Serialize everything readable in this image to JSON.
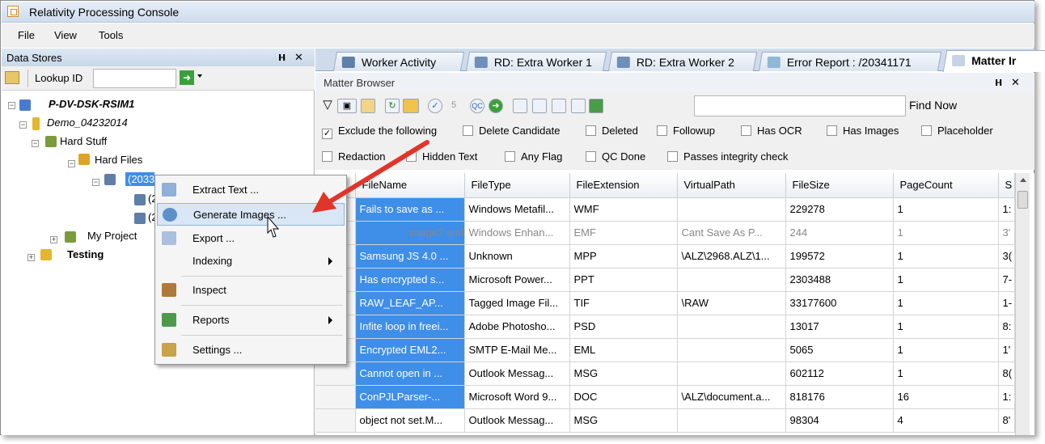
{
  "window": {
    "title": "Relativity Processing Console"
  },
  "menu": [
    "File",
    "View",
    "Tools"
  ],
  "data_stores": {
    "title": "Data Stores",
    "pin_label": "p",
    "close_label": "✕",
    "lookup_label": "Lookup ID",
    "lookup_value": "",
    "tree": {
      "server": "P-DV-DSK-RSIM1",
      "demo": "Demo_04232014",
      "hard_stuff": "Hard Stuff",
      "hard_files": "Hard Files",
      "job1": "(20337175) ...",
      "job2": "(2",
      "job3": "(2",
      "my_project": "My Project",
      "testing": "Testing"
    }
  },
  "context_menu": {
    "items": [
      {
        "label": "Extract Text ...",
        "submenu": false
      },
      {
        "label": "Generate Images ...",
        "submenu": false,
        "highlighted": true
      },
      {
        "label": "Export ...",
        "submenu": false
      },
      {
        "label": "Indexing",
        "submenu": true
      },
      {
        "label": "Inspect",
        "submenu": false
      },
      {
        "label": "Reports",
        "submenu": true
      },
      {
        "label": "Settings ...",
        "submenu": false
      }
    ]
  },
  "tabs": [
    {
      "label": "Worker Activity"
    },
    {
      "label": "RD: Extra Worker 1"
    },
    {
      "label": "RD: Extra Worker 2"
    },
    {
      "label": "Error Report : /20341171"
    },
    {
      "label": "Matter Ir"
    }
  ],
  "matter_browser": {
    "title": "Matter Browser",
    "search_value": "",
    "find_now": "Find Now",
    "filters_row1": [
      {
        "label": "Exclude the following",
        "checked": true
      },
      {
        "label": "Delete Candidate",
        "checked": false
      },
      {
        "label": "Deleted",
        "checked": false
      },
      {
        "label": "Followup",
        "checked": false
      },
      {
        "label": "Has OCR",
        "checked": false
      },
      {
        "label": "Has Images",
        "checked": false
      },
      {
        "label": "Placeholder",
        "checked": false
      }
    ],
    "filters_row2": [
      {
        "label": "Redaction",
        "checked": false
      },
      {
        "label": "Hidden Text",
        "checked": false
      },
      {
        "label": "Any Flag",
        "checked": false
      },
      {
        "label": "QC Done",
        "checked": false
      },
      {
        "label": "Passes integrity check",
        "checked": false
      }
    ],
    "columns": [
      "FileName",
      "FileType",
      "FileExtension",
      "VirtualPath",
      "FileSize",
      "PageCount",
      "S"
    ],
    "rows": [
      [
        "Fails to save as ...",
        "Windows Metafil...",
        "WMF",
        "",
        "229278",
        "1",
        "1:"
      ],
      [
        "image2.emf",
        "Windows Enhan...",
        "EMF",
        "Cant Save As P...",
        "244",
        "1",
        "3'"
      ],
      [
        "Samsung JS 4.0 ...",
        "Unknown",
        "MPP",
        "\\ALZ\\2968.ALZ\\1...",
        "199572",
        "1",
        "3("
      ],
      [
        "Has encrypted s...",
        "Microsoft Power...",
        "PPT",
        "",
        "2303488",
        "1",
        "7-"
      ],
      [
        "RAW_LEAF_AP...",
        "Tagged Image Fil...",
        "TIF",
        "\\RAW",
        "33177600",
        "1",
        "1-"
      ],
      [
        "Infite loop in freei...",
        "Adobe Photosho...",
        "PSD",
        "",
        "13017",
        "1",
        "8:"
      ],
      [
        "Encrypted EML2...",
        "SMTP E-Mail Me...",
        "EML",
        "",
        "5065",
        "1",
        "1'"
      ],
      [
        "Cannot open in ...",
        "Outlook Messag...",
        "MSG",
        "",
        "602112",
        "1",
        "8("
      ],
      [
        "ConPJLParser-...",
        "Microsoft Word 9...",
        "DOC",
        "\\ALZ\\document.a...",
        "818176",
        "16",
        "1:"
      ],
      [
        "object not set.M...",
        "Outlook Messag...",
        "MSG",
        "",
        "98304",
        "4",
        "8'"
      ]
    ]
  },
  "colors": {
    "selection": "#3f8ee8",
    "annotation_arrow": "#e0352b"
  }
}
